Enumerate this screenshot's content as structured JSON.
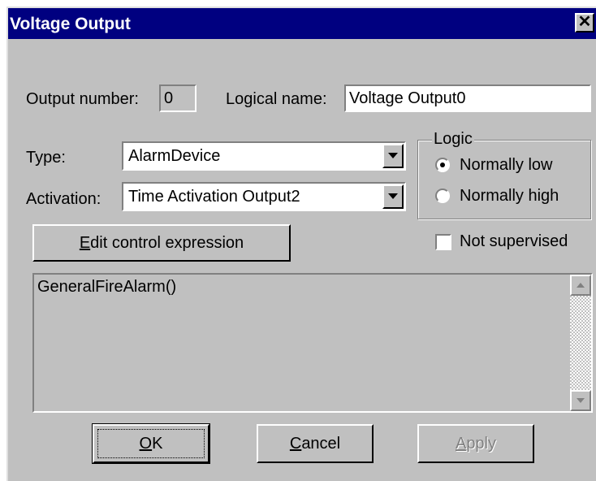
{
  "window": {
    "title": "Voltage Output",
    "close_glyph": "✕"
  },
  "output_number": {
    "label": "Output number:",
    "value": "0"
  },
  "logical_name": {
    "label": "Logical name:",
    "value": "Voltage Output0"
  },
  "type": {
    "label": "Type:",
    "value": "AlarmDevice"
  },
  "activation": {
    "label": "Activation:",
    "value": "Time Activation Output2"
  },
  "logic": {
    "legend": "Logic",
    "options": [
      {
        "label": "Normally low",
        "selected": true
      },
      {
        "label": "Normally high",
        "selected": false
      }
    ]
  },
  "not_supervised": {
    "label": "Not supervised",
    "checked": false
  },
  "edit_button": {
    "mnemonic": "E",
    "rest": "dit control expression"
  },
  "expression": {
    "text": "GeneralFireAlarm()"
  },
  "buttons": {
    "ok": {
      "mnemonic": "O",
      "rest": "K"
    },
    "cancel": {
      "mnemonic": "C",
      "rest": "ancel"
    },
    "apply": {
      "mnemonic": "A",
      "rest": "pply"
    }
  },
  "icons": {
    "close": "close-icon",
    "dropdown": "chevron-down-icon",
    "scroll_up": "scroll-up-arrow-icon",
    "scroll_down": "scroll-down-arrow-icon"
  },
  "colors": {
    "titlebar": "#000080",
    "face": "#c0c0c0",
    "disabled_text": "#808080"
  }
}
